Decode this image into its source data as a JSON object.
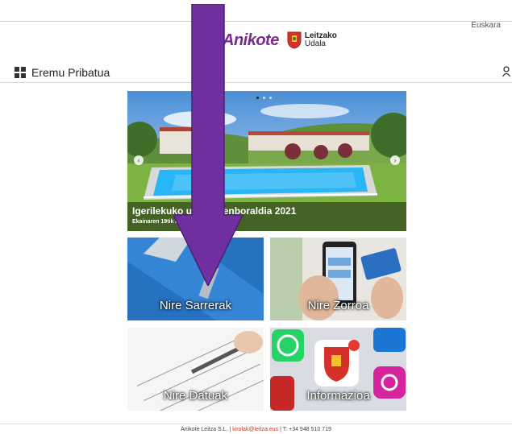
{
  "header": {
    "language": "Euskara",
    "brand": "Anikote",
    "municipality_line1": "Leitzako",
    "municipality_line2": "Udala"
  },
  "private_bar": {
    "title": "Eremu Pribatua",
    "icon": "grid-icon",
    "user_icon": "user-icon"
  },
  "carousel": {
    "title": "Igerilekuko udako denboraldia 2021",
    "subtitle": "Ekainaren 19tik irailaren 12ra",
    "prev_icon": "‹",
    "next_icon": "›"
  },
  "tiles": [
    {
      "label": "Nire Sarrerak"
    },
    {
      "label": "Nire Zorroa"
    },
    {
      "label": "Nire Datuak"
    },
    {
      "label": "Informazioa"
    }
  ],
  "footer": {
    "company": "Anikote Leitza S.L.",
    "sep1": " | ",
    "email": "kirolak@leitza.eus",
    "sep2": " | ",
    "phone": "T: +34 948 510 719"
  },
  "colors": {
    "brand": "#7a2b8c",
    "arrow": "#7030a0",
    "link": "#c0392b"
  }
}
